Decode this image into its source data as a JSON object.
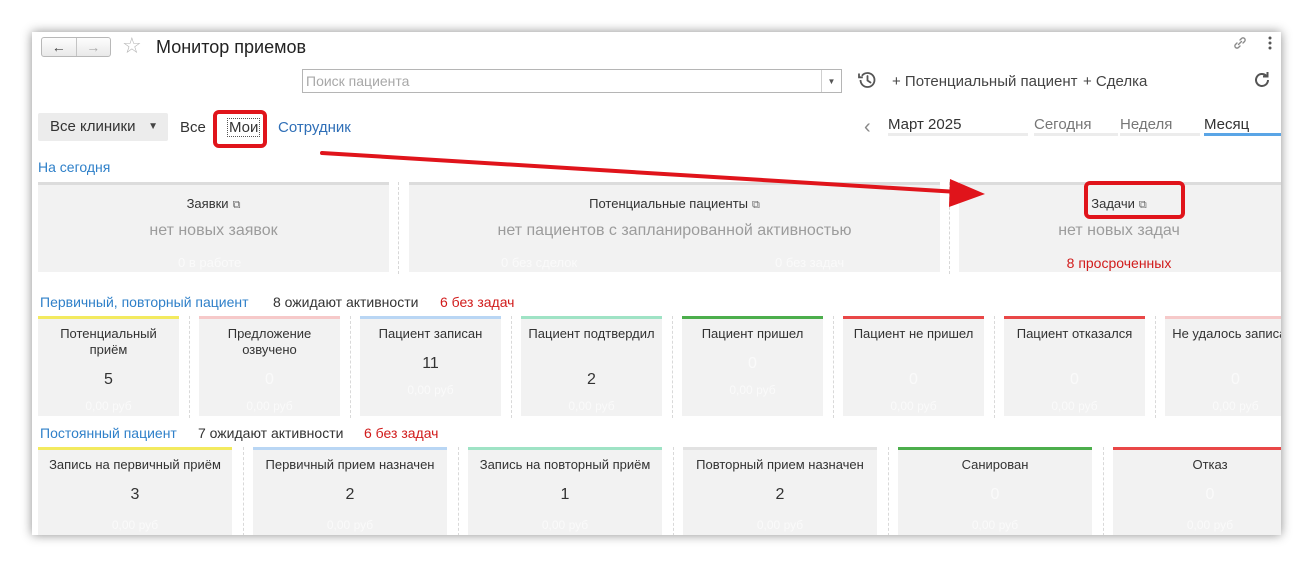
{
  "window": {
    "title": "Монитор приемов",
    "back_icon": "←",
    "forward_icon": "→",
    "favorite_icon": "☆"
  },
  "toolbar": {
    "search_placeholder": "Поиск пациента",
    "search_value": "",
    "add_potential_patient": "+ Потенциальный пациент",
    "add_deal": "+ Сделка"
  },
  "filters": {
    "clinic_select": "Все клиники",
    "all": "Все",
    "mine": "Мои",
    "employee": "Сотрудник"
  },
  "period": {
    "month": "Март 2025",
    "today": "Сегодня",
    "week": "Неделя",
    "month_tab": "Месяц",
    "active": "month",
    "active_color": "#5aa5e6"
  },
  "today": {
    "label": "На сегодня",
    "cards": [
      {
        "title": "Заявки",
        "main": "нет новых заявок",
        "sub_left": "0 в работе",
        "sub_right": ""
      },
      {
        "title": "Потенциальные пациенты",
        "main": "нет пациентов с запланированной активностью",
        "sub_left": "0 без сделок",
        "sub_right": "0 без задач"
      },
      {
        "title": "Задачи",
        "main": "нет новых задач",
        "overdue": "8 просроченных"
      }
    ]
  },
  "primary_funnel": {
    "label": "Первичный, повторный пациент",
    "waiting": "8 ожидают активности",
    "no_tasks": "6 без задач",
    "stages": [
      {
        "name": "Потенциальный приём",
        "count": "5",
        "sum": "0,00 руб",
        "color": "#f3ea5f"
      },
      {
        "name": "Предложение озвучено",
        "count": "0",
        "sum": "0,00 руб",
        "color": "#f6c9c9"
      },
      {
        "name": "Пациент записан",
        "count": "11",
        "sum": "0,00 руб",
        "color": "#b9d6f4"
      },
      {
        "name": "Пациент подтвердил",
        "count": "2",
        "sum": "0,00 руб",
        "color": "#9fe3c5"
      },
      {
        "name": "Пациент пришел",
        "count": "0",
        "sum": "0,00 руб",
        "color": "#4cae4c"
      },
      {
        "name": "Пациент не пришел",
        "count": "0",
        "sum": "0,00 руб",
        "color": "#e94747"
      },
      {
        "name": "Пациент отказался",
        "count": "0",
        "sum": "0,00 руб",
        "color": "#e94747"
      },
      {
        "name": "Не удалось записать",
        "count": "0",
        "sum": "0,00 руб",
        "color": "#f6c9c9"
      }
    ]
  },
  "regular_funnel": {
    "label": "Постоянный пациент",
    "waiting": "7 ожидают активности",
    "no_tasks": "6 без задач",
    "stages": [
      {
        "name": "Запись на первичный приём",
        "count": "3",
        "sum": "0,00 руб",
        "color": "#f3ea5f"
      },
      {
        "name": "Первичный прием назначен",
        "count": "2",
        "sum": "0,00 руб",
        "color": "#b9d6f4"
      },
      {
        "name": "Запись на повторный приём",
        "count": "1",
        "sum": "0,00 руб",
        "color": "#9fe3c5"
      },
      {
        "name": "Повторный прием назначен",
        "count": "2",
        "sum": "0,00 руб",
        "color": "#e2e2e2"
      },
      {
        "name": "Санирован",
        "count": "0",
        "sum": "0,00 руб",
        "color": "#4cae4c"
      },
      {
        "name": "Отказ",
        "count": "0",
        "sum": "0,00 руб",
        "color": "#e94747"
      }
    ]
  },
  "colors": {
    "link": "#2f80c9",
    "overdue": "#d11b1b",
    "annotation": "#e0141b"
  }
}
